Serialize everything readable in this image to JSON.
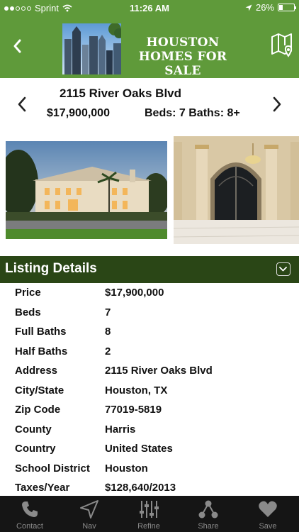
{
  "status_bar": {
    "carrier": "Sprint",
    "time": "11:26 AM",
    "battery": "26%",
    "battery_level": 0.26,
    "signal_dots_filled": 2,
    "signal_dots_total": 5
  },
  "app_header": {
    "title_line1": "HOUSTON",
    "title_line2": "HOMES FOR SALE",
    "back_icon": "chevron-left-icon",
    "map_icon": "map-pin-icon",
    "background": "#5f9a3a"
  },
  "listing": {
    "address": "2115 River Oaks Blvd",
    "price": "$17,900,000",
    "beds_baths": "Beds: 7  Baths: 8+"
  },
  "section": {
    "title": "Listing Details",
    "background": "#2a4616",
    "collapse_icon": "chevron-down-icon"
  },
  "details": [
    {
      "label": "Price",
      "value": "$17,900,000"
    },
    {
      "label": "Beds",
      "value": "7"
    },
    {
      "label": "Full Baths",
      "value": "8"
    },
    {
      "label": "Half Baths",
      "value": "2"
    },
    {
      "label": "Address",
      "value": "2115 River Oaks Blvd"
    },
    {
      "label": "City/State",
      "value": "Houston, TX"
    },
    {
      "label": "Zip Code",
      "value": "77019-5819"
    },
    {
      "label": "County",
      "value": "Harris"
    },
    {
      "label": "Country",
      "value": "United States"
    },
    {
      "label": "School District",
      "value": "Houston"
    },
    {
      "label": "Taxes/Year",
      "value": "$128,640/2013"
    }
  ],
  "tabs": [
    {
      "label": "Contact",
      "icon": "phone-icon"
    },
    {
      "label": "Nav",
      "icon": "navigation-arrow-icon"
    },
    {
      "label": "Refine",
      "icon": "sliders-icon"
    },
    {
      "label": "Share",
      "icon": "share-icon"
    },
    {
      "label": "Save",
      "icon": "heart-icon"
    }
  ]
}
